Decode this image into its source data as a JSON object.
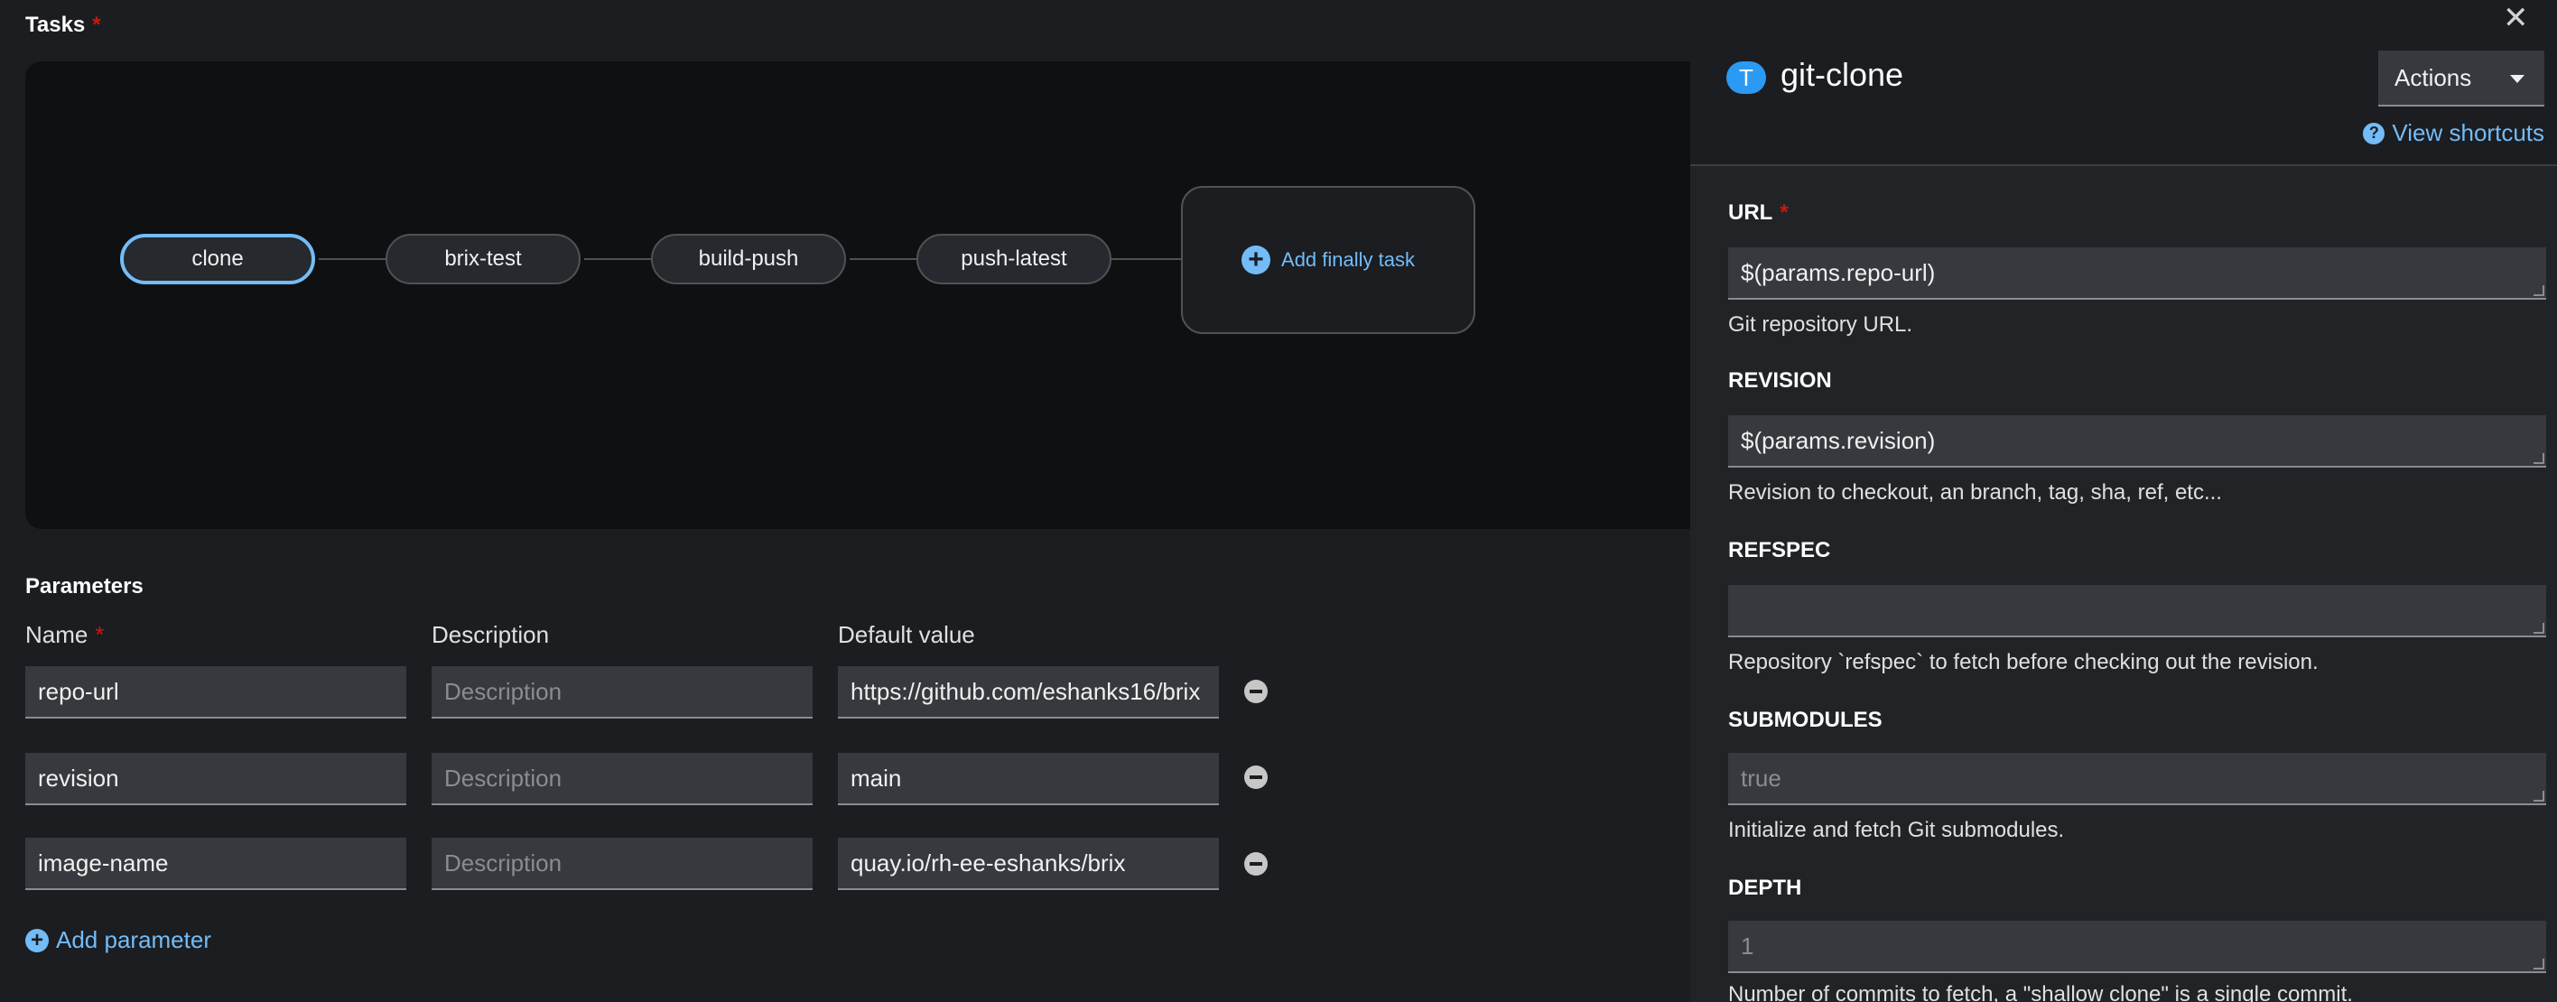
{
  "tasks_section": {
    "title": "Tasks",
    "required_marker": "*",
    "nodes": [
      "clone",
      "brix-test",
      "build-push",
      "push-latest"
    ],
    "add_finally_label": "Add finally task"
  },
  "parameters_section": {
    "title": "Parameters",
    "columns": {
      "name": "Name",
      "name_required": "*",
      "description": "Description",
      "default_value": "Default value"
    },
    "rows": [
      {
        "name": "repo-url",
        "description_placeholder": "Description",
        "default_value": "https://github.com/eshanks16/brix"
      },
      {
        "name": "revision",
        "description_placeholder": "Description",
        "default_value": "main"
      },
      {
        "name": "image-name",
        "description_placeholder": "Description",
        "default_value": "quay.io/rh-ee-eshanks/brix"
      }
    ],
    "add_parameter_label": "Add parameter"
  },
  "side_panel": {
    "close_symbol": "✕",
    "badge": "T",
    "title": "git-clone",
    "actions_label": "Actions",
    "view_shortcuts_label": "View shortcuts",
    "fields": [
      {
        "label": "URL",
        "required": "*",
        "value": "$(params.repo-url)",
        "placeholder": "",
        "help": "Git repository URL."
      },
      {
        "label": "REVISION",
        "required": "",
        "value": "$(params.revision)",
        "placeholder": "",
        "help": "Revision to checkout, an branch, tag, sha, ref, etc..."
      },
      {
        "label": "REFSPEC",
        "required": "",
        "value": "",
        "placeholder": "",
        "help": "Repository `refspec` to fetch before checking out the revision."
      },
      {
        "label": "SUBMODULES",
        "required": "",
        "value": "",
        "placeholder": "true",
        "help": "Initialize and fetch Git submodules."
      },
      {
        "label": "DEPTH",
        "required": "",
        "value": "",
        "placeholder": "1",
        "help": "Number of commits to fetch, a \"shallow clone\" is a single commit."
      }
    ]
  }
}
